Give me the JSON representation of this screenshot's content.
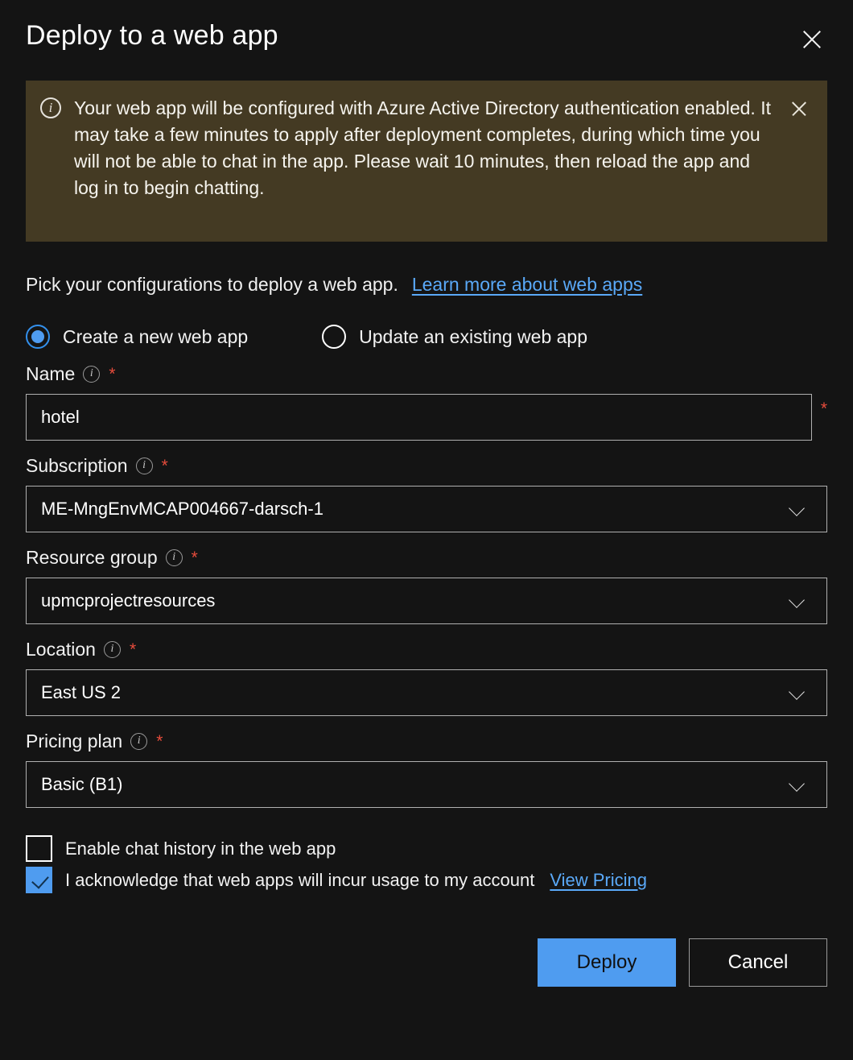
{
  "dialog": {
    "title": "Deploy to a web app",
    "close_icon": "close-icon"
  },
  "banner": {
    "icon": "info-circle-icon",
    "message": "Your web app will be configured with Azure Active Directory authentication enabled. It may take a few minutes to apply after deployment completes, during which time you will not be able to chat in the app. Please wait 10 minutes, then reload the app and log in to begin chatting.",
    "close_icon": "close-icon",
    "background_color": "#443a23"
  },
  "intro": {
    "text": "Pick your configurations to deploy a web app.",
    "link_label": "Learn more about web apps",
    "link_color": "#5aa9f8"
  },
  "mode_options": [
    {
      "label": "Create a new web app",
      "selected": true
    },
    {
      "label": "Update an existing web app",
      "selected": false
    }
  ],
  "fields": [
    {
      "label": "Name",
      "required_mark": "*",
      "info_icon": "info-icon",
      "type": "text",
      "value": "hotel",
      "trailing_required_mark": "*"
    },
    {
      "label": "Subscription",
      "required_mark": "*",
      "info_icon": "info-icon",
      "type": "select",
      "value": "ME-MngEnvMCAP004667-darsch-1",
      "chevron_icon": "chevron-down-icon"
    },
    {
      "label": "Resource group",
      "required_mark": "*",
      "info_icon": "info-icon",
      "type": "select",
      "value": "upmcprojectresources",
      "chevron_icon": "chevron-down-icon"
    },
    {
      "label": "Location",
      "required_mark": "*",
      "info_icon": "info-icon",
      "type": "select",
      "value": "East US 2",
      "chevron_icon": "chevron-down-icon"
    },
    {
      "label": "Pricing plan",
      "required_mark": "*",
      "info_icon": "info-icon",
      "type": "select",
      "value": "Basic (B1)",
      "chevron_icon": "chevron-down-icon"
    }
  ],
  "checkboxes": [
    {
      "label": "Enable chat history in the web app",
      "checked": false
    },
    {
      "label": "I acknowledge that web apps will incur usage to my account",
      "checked": true,
      "link_label": "View Pricing"
    }
  ],
  "footer": {
    "deploy_label": "Deploy",
    "cancel_label": "Cancel",
    "accent_color": "#4f9cf0"
  }
}
